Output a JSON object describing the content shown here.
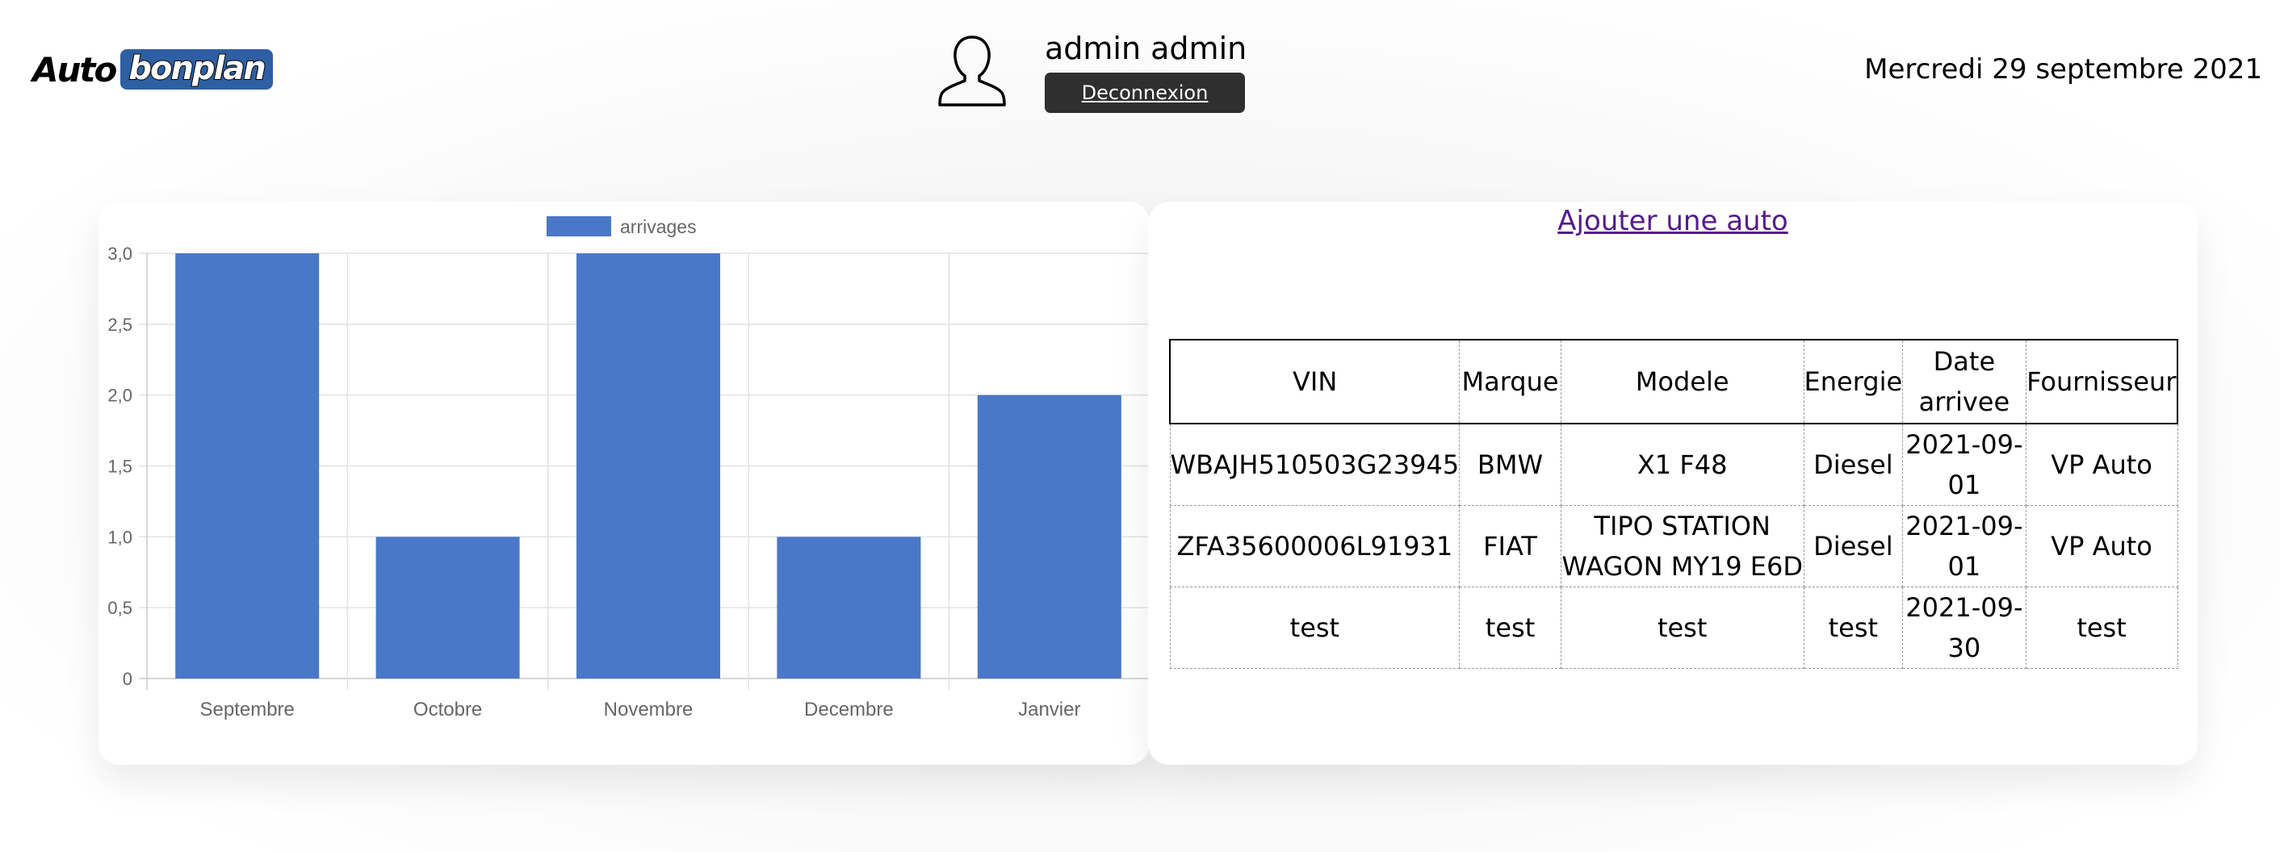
{
  "header": {
    "logo_left": "Auto",
    "logo_right": "bonplan",
    "user_name": "admin admin",
    "logout_label": "Deconnexion",
    "date": "Mercredi 29 septembre 2021",
    "user_icon": "user-silhouette-icon",
    "logo_color": "#2e5fa3"
  },
  "chart_data": {
    "type": "bar",
    "categories": [
      "Septembre",
      "Octobre",
      "Novembre",
      "Decembre",
      "Janvier"
    ],
    "series": [
      {
        "name": "arrivages",
        "values": [
          3,
          1,
          3,
          1,
          2
        ],
        "color": "#4a78c8"
      }
    ],
    "ylim": [
      0,
      3
    ],
    "yticks": [
      "0",
      "0,5",
      "1,0",
      "1,5",
      "2,0",
      "2,5",
      "3,0"
    ],
    "grid": true,
    "legend": "top-center"
  },
  "table": {
    "add_link": "Ajouter une auto",
    "headers": [
      "VIN",
      "Marque",
      "Modele",
      "Energie",
      "Date arrivee",
      "Fournisseur"
    ],
    "rows": [
      [
        "WBAJH510503G23945",
        "BMW",
        "X1 F48",
        "Diesel",
        "2021-09-01",
        "VP Auto"
      ],
      [
        "ZFA35600006L91931",
        "FIAT",
        "TIPO STATION WAGON MY19 E6D",
        "Diesel",
        "2021-09-01",
        "VP Auto"
      ],
      [
        "test",
        "test",
        "test",
        "test",
        "2021-09-30",
        "test"
      ]
    ]
  }
}
